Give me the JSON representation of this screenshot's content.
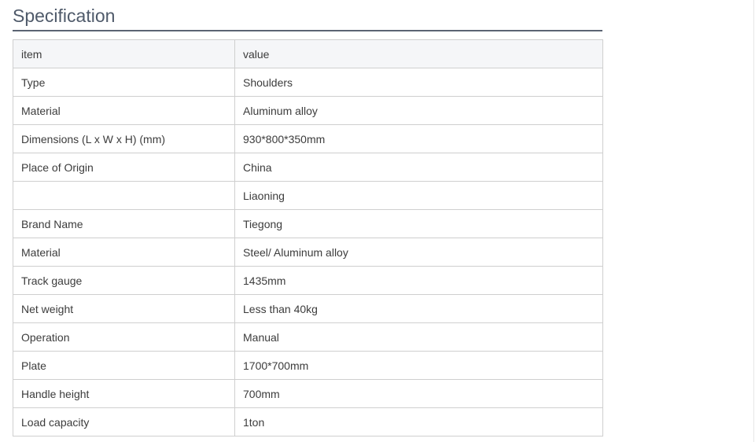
{
  "section": {
    "title": "Specification"
  },
  "table": {
    "headers": {
      "item": "item",
      "value": "value"
    },
    "rows": [
      {
        "item": "Type",
        "value": "Shoulders"
      },
      {
        "item": "Material",
        "value": "Aluminum alloy"
      },
      {
        "item": "Dimensions (L x W x H) (mm)",
        "value": "930*800*350mm"
      },
      {
        "item": "Place of Origin",
        "value": "China"
      },
      {
        "item": "",
        "value": "Liaoning"
      },
      {
        "item": "Brand Name",
        "value": "Tiegong"
      },
      {
        "item": "Material",
        "value": "Steel/ Aluminum alloy"
      },
      {
        "item": "Track gauge",
        "value": "1435mm"
      },
      {
        "item": "Net weight",
        "value": "Less than 40kg"
      },
      {
        "item": "Operation",
        "value": "Manual"
      },
      {
        "item": "Plate",
        "value": "1700*700mm"
      },
      {
        "item": "Handle height",
        "value": "700mm"
      },
      {
        "item": "Load capacity",
        "value": "1ton"
      }
    ]
  },
  "colors": {
    "title": "#4f5a6a",
    "underline": "#5b6472",
    "border": "#cfcfcf",
    "header_bg": "#f5f6f8",
    "text": "#3c3c3c"
  }
}
